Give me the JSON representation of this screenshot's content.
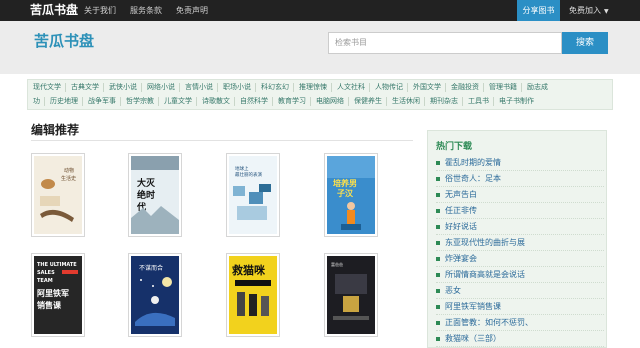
{
  "topbar": {
    "brand": "苦瓜书盘",
    "nav": [
      "关于我们",
      "服务条款",
      "免责声明"
    ],
    "share_button": "分享图书",
    "join_label": "免费加入"
  },
  "header": {
    "logo": "苦瓜书盘",
    "search_placeholder": "检索书目",
    "search_button": "搜索"
  },
  "categories": {
    "row1": [
      "现代文学",
      "古典文学",
      "武侠小说",
      "网络小说",
      "言情小说",
      "职场小说",
      "科幻玄幻",
      "推理惊悚",
      "人文社科",
      "人物传记",
      "外国文学",
      "金融投资",
      "管理书籍",
      "励志成"
    ],
    "row2": [
      "功",
      "历史地理",
      "战争军事",
      "哲学宗教",
      "儿童文学",
      "诗歌散文",
      "自然科学",
      "教育学习",
      "电脑网络",
      "保健养生",
      "生活休闲",
      "期刊杂志",
      "工具书",
      "电子书制作"
    ]
  },
  "main": {
    "title": "编辑推荐",
    "books": [
      {
        "cover_color": "#f3ede0",
        "cover_text": "动物生活史"
      },
      {
        "cover_color": "#dfe6ea",
        "cover_text": "大灭绝时代"
      },
      {
        "cover_color": "#e9f1f6",
        "cover_text": "地球上最壮丽的表演"
      },
      {
        "cover_color": "#2c7fc1",
        "cover_text": "培养男子汉"
      },
      {
        "cover_color": "#2a2a2a",
        "cover_text": "THE ULTIMATE SALES TEAM 阿里铁军销售课"
      },
      {
        "cover_color": "#1f3d7a",
        "cover_text": "不谋而合"
      },
      {
        "cover_color": "#f2d21d",
        "cover_text": "救猫咪"
      },
      {
        "cover_color": "#222228",
        "cover_text": "富爸爸"
      }
    ]
  },
  "sidebar": {
    "title": "热门下载",
    "items": [
      "霍乱时期的爱情",
      "俗世奇人：足本",
      "无声告白",
      "任正非传",
      "好好说话",
      "东亚现代性的曲折与展",
      "炸弹宴会",
      "所谓情商高就是会说话",
      "恶女",
      "阿里铁军销售课",
      "正面管教：如何不惩罚、",
      "救猫咪（三部）"
    ]
  }
}
